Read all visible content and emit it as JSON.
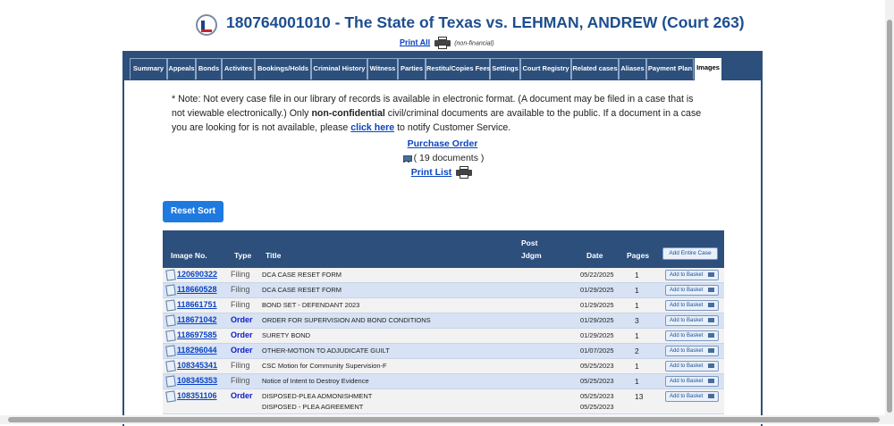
{
  "header": {
    "title": "180764001010 - The State of Texas vs. LEHMAN, ANDREW (Court 263)",
    "print_all": "Print All",
    "non_financial": "(non-financial)"
  },
  "tabs": [
    {
      "label": "Summary",
      "active": false
    },
    {
      "label": "Appeals",
      "active": false
    },
    {
      "label": "Bonds",
      "active": false
    },
    {
      "label": "Activites",
      "active": false
    },
    {
      "label": "Bookings/Holds",
      "active": false
    },
    {
      "label": "Criminal History",
      "active": false
    },
    {
      "label": "Witness",
      "active": false
    },
    {
      "label": "Parties",
      "active": false
    },
    {
      "label": "Restitu/Copies Fees",
      "active": false
    },
    {
      "label": "Settings",
      "active": false
    },
    {
      "label": "Court Registry",
      "active": false
    },
    {
      "label": "Related cases",
      "active": false
    },
    {
      "label": "Aliases",
      "active": false
    },
    {
      "label": "Payment Plan",
      "active": false
    },
    {
      "label": "Images",
      "active": true
    }
  ],
  "note": {
    "part1": "* Note: Not every case file in our library of records is available in electronic format. (A document may be filed in a case that is not viewable electronically.) Only ",
    "bold": "non-confidential",
    "part2": " civil/criminal documents are available to the public. If a document in a case you are looking for is not available, please ",
    "link": "click here",
    "part3": " to notify Customer Service."
  },
  "purchase": {
    "order_link": "Purchase Order",
    "doc_count": "( 19 documents )",
    "print_list": "Print List"
  },
  "reset_sort": "Reset Sort",
  "table": {
    "headers": {
      "image_no": "Image No.",
      "type": "Type",
      "title": "Title",
      "post": "Post",
      "jdgm": "Jdgm",
      "date": "Date",
      "pages": "Pages",
      "add_case": "Add Entire Case"
    },
    "add_label": "Add to Basket",
    "rows": [
      {
        "image_no": "120690322",
        "type": "Filing",
        "title": "DCA CASE RESET FORM",
        "date": "05/22/2025",
        "pages": "1"
      },
      {
        "image_no": "118660528",
        "type": "Filing",
        "title": "DCA CASE RESET FORM",
        "date": "01/29/2025",
        "pages": "1"
      },
      {
        "image_no": "118661751",
        "type": "Filing",
        "title": "BOND SET - DEFENDANT 2023",
        "date": "01/29/2025",
        "pages": "1"
      },
      {
        "image_no": "118671042",
        "type": "Order",
        "title": "ORDER FOR SUPERVISION AND BOND CONDITIONS",
        "date": "01/29/2025",
        "pages": "3"
      },
      {
        "image_no": "118697585",
        "type": "Order",
        "title": "SURETY BOND",
        "date": "01/29/2025",
        "pages": "1"
      },
      {
        "image_no": "118296044",
        "type": "Order",
        "title": "OTHER-MOTION TO ADJUDICATE GUILT",
        "date": "01/07/2025",
        "pages": "2"
      },
      {
        "image_no": "108345341",
        "type": "Filing",
        "title": "CSC Motion for Community Supervision-F",
        "date": "05/25/2023",
        "pages": "1"
      },
      {
        "image_no": "108345353",
        "type": "Filing",
        "title": "Notice of Intent to Destroy Evidence",
        "date": "05/25/2023",
        "pages": "1"
      },
      {
        "image_no": "108351106",
        "type": "Order",
        "title": "DISPOSED-PLEA ADMONISHMENT",
        "title2": "DISPOSED - PLEA AGREEMENT",
        "date": "05/25/2023",
        "date2": "05/25/2023",
        "pages": "13"
      }
    ]
  }
}
